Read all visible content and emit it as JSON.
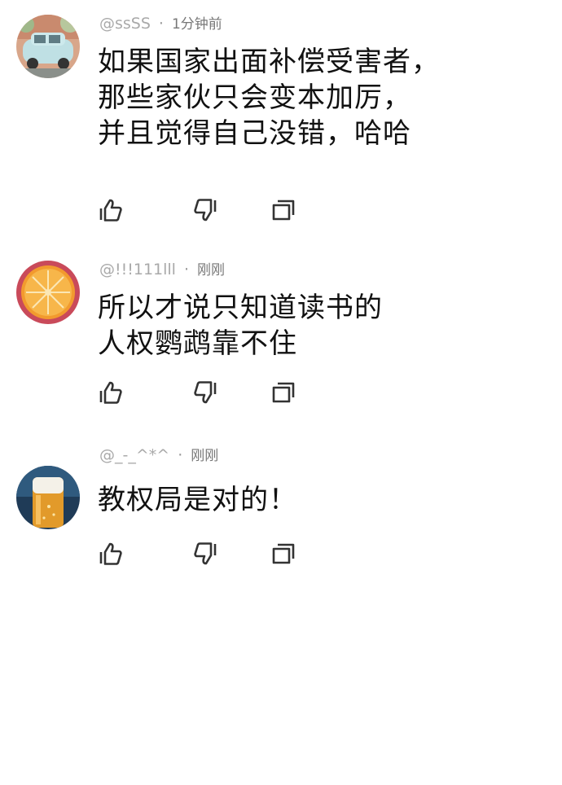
{
  "comments": [
    {
      "username": "@ssSS",
      "time": "1分钟前",
      "text": "如果国家出面补偿受害者，\n那些家伙只会变本加厉，\n并且觉得自己没错，哈哈",
      "avatar_icon": "vintage-car-avatar"
    },
    {
      "username": "@!!!111lll",
      "time": "刚刚",
      "text": "所以才说只知道读书的\n人权鹦鹉靠不住",
      "avatar_icon": "orange-slice-avatar"
    },
    {
      "username": "@_-_^*^",
      "time": "刚刚",
      "text": "教权局是对的！",
      "avatar_icon": "beer-glass-avatar"
    }
  ],
  "separator": "·",
  "action_icons": [
    "like-icon",
    "dislike-icon",
    "reply-icon"
  ]
}
